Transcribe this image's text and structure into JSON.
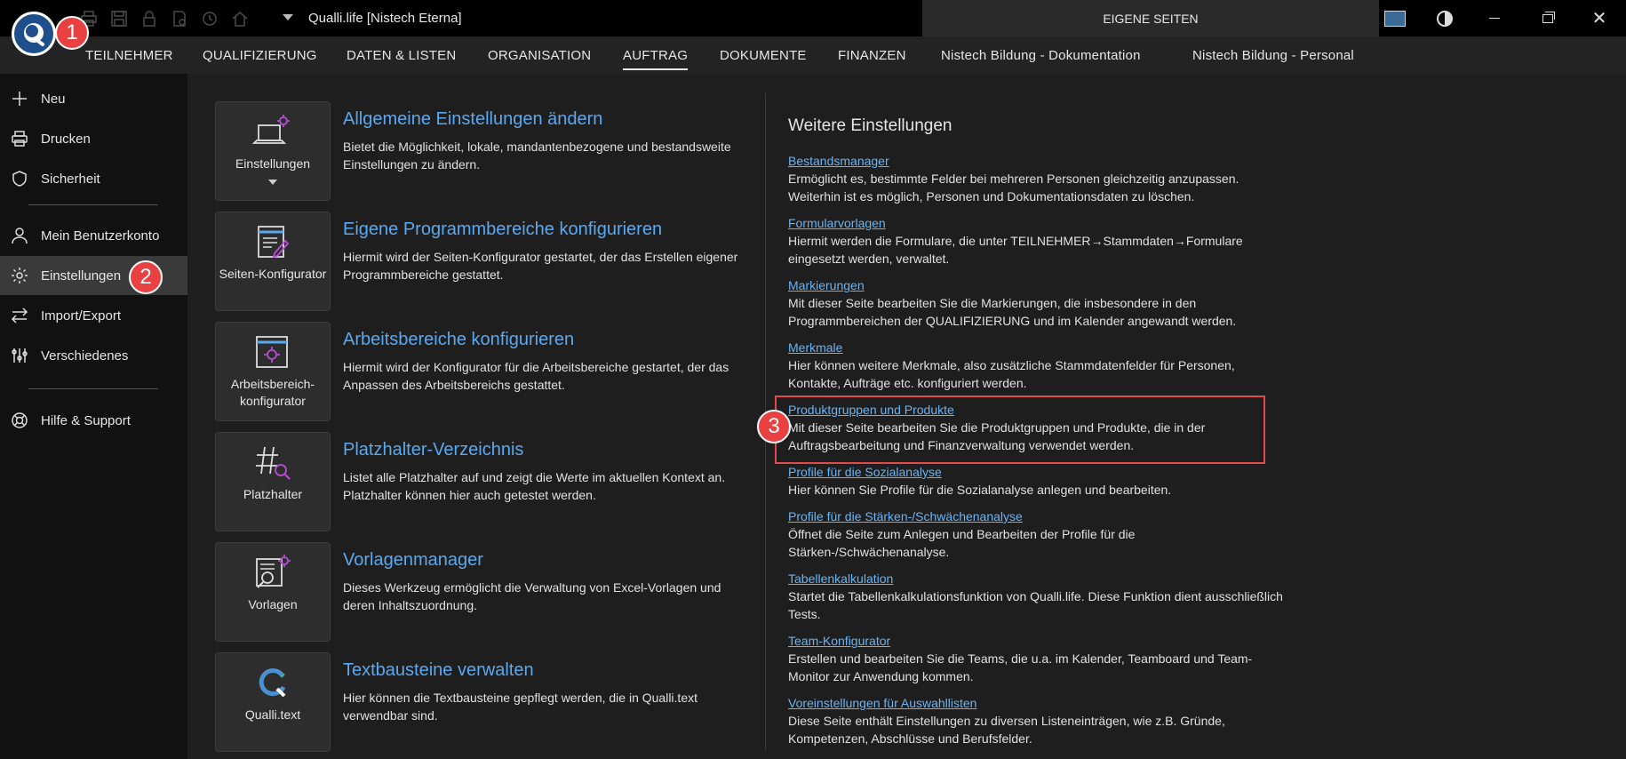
{
  "titlebar": {
    "app_title": "Qualli.life [Nistech Eterna]",
    "eigene_seiten": "EIGENE SEITEN",
    "quick_access_icons": [
      "print-icon",
      "save-icon",
      "lock-icon",
      "report-icon",
      "refresh-icon",
      "home-icon"
    ],
    "close_symbol": "✕"
  },
  "badges": {
    "b1": "1",
    "b2": "2",
    "b3": "3"
  },
  "menu": {
    "items": [
      {
        "label": "TEILNEHMER"
      },
      {
        "label": "QUALIFIZIERUNG"
      },
      {
        "label": "DATEN & LISTEN"
      },
      {
        "label": "ORGANISATION"
      },
      {
        "label": "AUFTRAG"
      },
      {
        "label": "DOKUMENTE"
      },
      {
        "label": "FINANZEN"
      },
      {
        "label": "Nistech Bildung - Dokumentation"
      },
      {
        "label": "Nistech Bildung - Personal"
      }
    ],
    "active": "AUFTRAG"
  },
  "sidebar": {
    "items": [
      {
        "label": "Neu",
        "icon": "plus-icon"
      },
      {
        "label": "Drucken",
        "icon": "print-icon"
      },
      {
        "label": "Sicherheit",
        "icon": "shield-icon"
      },
      {
        "label": "Mein Benutzerkonto",
        "icon": "user-icon"
      },
      {
        "label": "Einstellungen",
        "icon": "gear-icon"
      },
      {
        "label": "Import/Export",
        "icon": "arrows-icon"
      },
      {
        "label": "Verschiedenes",
        "icon": "tools-icon"
      },
      {
        "label": "Hilfe & Support",
        "icon": "lifebuoy-icon"
      }
    ],
    "active": "Einstellungen"
  },
  "features": [
    {
      "tile_label": "Einstellungen",
      "title": "Allgemeine Einstellungen ändern",
      "desc": "Bietet die Möglichkeit, lokale, mandantenbezogene und bestandsweite Einstellungen zu ändern."
    },
    {
      "tile_label": "Seiten-Konfigurator",
      "title": "Eigene Programmbereiche konfigurieren",
      "desc": "Hiermit wird der Seiten-Konfigurator gestartet, der das Erstellen eigener Programmbereiche gestattet."
    },
    {
      "tile_label": "Arbeitsbereich-konfigurator",
      "title": "Arbeitsbereiche konfigurieren",
      "desc": "Hiermit wird der Konfigurator für die Arbeitsbereiche gestartet, der das Anpassen des Arbeitsbereichs gestattet."
    },
    {
      "tile_label": "Platzhalter",
      "title": "Platzhalter-Verzeichnis",
      "desc": "Listet alle Platzhalter auf und zeigt die Werte im aktuellen Kontext an. Platzhalter können hier auch getestet werden."
    },
    {
      "tile_label": "Vorlagen",
      "title": "Vorlagenmanager",
      "desc": "Dieses Werkzeug ermöglicht die Verwaltung von Excel-Vorlagen und deren Inhaltszuordnung."
    },
    {
      "tile_label": "Qualli.text",
      "title": "Textbausteine verwalten",
      "desc": "Hier können die Textbausteine gepflegt werden, die in Qualli.text verwendbar sind."
    }
  ],
  "weitere": {
    "title": "Weitere Einstellungen",
    "items": [
      {
        "link": "Bestandsmanager",
        "desc": "Ermöglicht es, bestimmte Felder bei mehreren Personen gleichzeitig anzupassen. Weiterhin ist es möglich, Personen und Dokumentationsdaten zu löschen."
      },
      {
        "link": "Formularvorlagen",
        "desc": "Hiermit werden die Formulare, die unter TEILNEHMER→Stammdaten→Formulare eingesetzt werden, verwaltet."
      },
      {
        "link": "Markierungen",
        "desc": "Mit dieser Seite bearbeiten Sie die Markierungen, die insbesondere in den Programmbereichen der QUALIFIZIERUNG und im Kalender angewandt werden."
      },
      {
        "link": "Merkmale",
        "desc": "Hier können weitere Merkmale, also zusätzliche Stammdatenfelder für Personen, Kontakte, Aufträge etc. konfiguriert werden."
      },
      {
        "link": "Produktgruppen und Produkte",
        "desc": "Mit dieser Seite bearbeiten Sie die Produktgruppen und Produkte, die in der Auftragsbearbeitung und Finanzverwaltung verwendet werden."
      },
      {
        "link": "Profile für die Sozialanalyse",
        "desc": "Hier können Sie Profile für die Sozialanalyse anlegen und bearbeiten."
      },
      {
        "link": "Profile für die Stärken-/Schwächenanalyse",
        "desc": "Öffnet die Seite zum Anlegen und Bearbeiten der Profile für die Stärken-/Schwächenanalyse."
      },
      {
        "link": "Tabellenkalkulation",
        "desc": "Startet die Tabellenkalkulationsfunktion von Qualli.life. Diese Funktion dient ausschließlich Tests."
      },
      {
        "link": "Team-Konfigurator",
        "desc": "Erstellen und bearbeiten Sie die Teams, die u.a. im Kalender, Teamboard und Team-Monitor zur Anwendung kommen."
      },
      {
        "link": "Voreinstellungen für Auswahllisten",
        "desc": "Diese Seite enthält Einstellungen zu diversen Listeneinträgen, wie z.B. Gründe, Kompetenzen, Abschlüsse und Berufsfelder."
      }
    ]
  },
  "colors": {
    "accent_link": "#6ab4f5",
    "badge_red": "#e94141",
    "highlight_red": "#e04a4a",
    "icon_purple": "#b84fd6"
  }
}
